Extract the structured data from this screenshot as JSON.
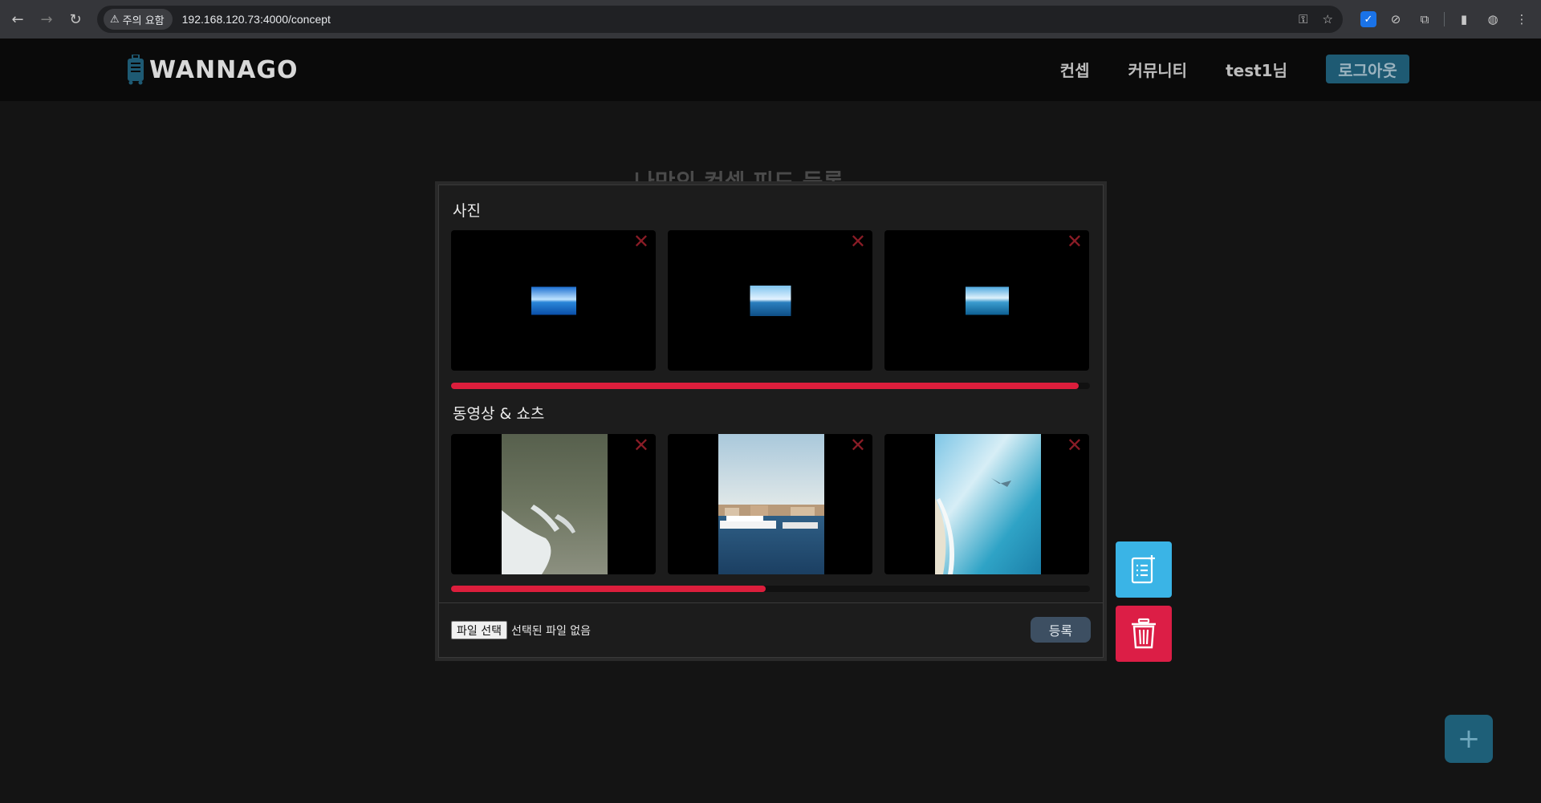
{
  "browser": {
    "security_chip": "주의 요함",
    "url": "192.168.120.73:4000/concept"
  },
  "header": {
    "logo_text": "WANNAGO",
    "nav": [
      "컨셉",
      "커뮤니티",
      "test1님"
    ],
    "logout_label": "로그아웃",
    "brand_color": "#1e5a73"
  },
  "background": {
    "title_fragment": "나만의 컨셉 피드 등록"
  },
  "modal": {
    "photos": {
      "title": "사진",
      "items": [
        {
          "type": "photo",
          "preview": "ocean-sky"
        },
        {
          "type": "photo",
          "preview": "ocean-horizon"
        },
        {
          "type": "photo",
          "preview": "ocean-clouds"
        }
      ],
      "progress": 0.983
    },
    "videos": {
      "title": "동영상 & 쇼츠",
      "items": [
        {
          "type": "video",
          "preview": "aerial-waves"
        },
        {
          "type": "video",
          "preview": "harbor-ship"
        },
        {
          "type": "video",
          "preview": "coast-aerial"
        }
      ],
      "progress": 0.492
    },
    "file_input": {
      "button_label": "파일 선택",
      "status": "선택된 파일 없음"
    },
    "register_label": "등록",
    "accent_color": "#dc1e3c"
  },
  "fabs": {
    "note_color": "#3ab4e6",
    "trash_color": "#dc1e46",
    "plus_label": "+"
  }
}
